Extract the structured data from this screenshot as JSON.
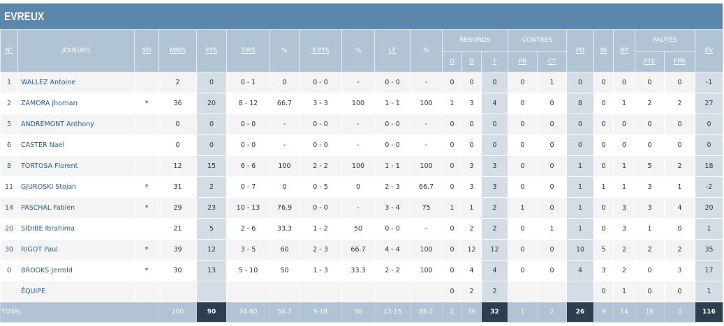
{
  "team": "EVREUX",
  "headers": {
    "num": "N°",
    "player": "JOUEURS",
    "starter": "5D",
    "mins": "MINS",
    "pts": "PTS",
    "shots": "TIRS",
    "pct": "%",
    "three": "3 PTS",
    "ft": "LF",
    "rebounds": "REBONDS",
    "reb_o": "O",
    "reb_d": "D",
    "reb_t": "T",
    "blocks": "CONTRES",
    "blk_pr": "PR",
    "blk_ct": "CT",
    "assists": "PD",
    "steals": "IN",
    "turnovers": "BP",
    "fouls": "FAUTES",
    "fouls_fte": "FTE",
    "fouls_fpr": "FPR",
    "eval": "ÉV"
  },
  "rows": [
    {
      "num": "1",
      "name": "WALLEZ Antoine",
      "starter": "",
      "mins": "2",
      "pts": "0",
      "tirs": "0 - 1",
      "tirs_pct": "0",
      "three": "0 - 0",
      "three_pct": "-",
      "lf": "0 - 0",
      "lf_pct": "-",
      "ro": "0",
      "rd": "0",
      "rt": "0",
      "pr": "0",
      "ct": "1",
      "pd": "0",
      "in": "0",
      "bp": "0",
      "fte": "0",
      "fpr": "0",
      "ev": "-1"
    },
    {
      "num": "2",
      "name": "ZAMORA Jhornan",
      "starter": "*",
      "mins": "36",
      "pts": "20",
      "tirs": "8 - 12",
      "tirs_pct": "66.7",
      "three": "3 - 3",
      "three_pct": "100",
      "lf": "1 - 1",
      "lf_pct": "100",
      "ro": "1",
      "rd": "3",
      "rt": "4",
      "pr": "0",
      "ct": "0",
      "pd": "8",
      "in": "0",
      "bp": "1",
      "fte": "2",
      "fpr": "2",
      "ev": "27"
    },
    {
      "num": "5",
      "name": "ANDREMONT Anthony",
      "starter": "",
      "mins": "0",
      "pts": "0",
      "tirs": "0 - 0",
      "tirs_pct": "-",
      "three": "0 - 0",
      "three_pct": "-",
      "lf": "0 - 0",
      "lf_pct": "-",
      "ro": "0",
      "rd": "0",
      "rt": "0",
      "pr": "0",
      "ct": "0",
      "pd": "0",
      "in": "0",
      "bp": "0",
      "fte": "0",
      "fpr": "0",
      "ev": "0"
    },
    {
      "num": "6",
      "name": "CASTER Nael",
      "starter": "",
      "mins": "0",
      "pts": "0",
      "tirs": "0 - 0",
      "tirs_pct": "-",
      "three": "0 - 0",
      "three_pct": "-",
      "lf": "0 - 0",
      "lf_pct": "-",
      "ro": "0",
      "rd": "0",
      "rt": "0",
      "pr": "0",
      "ct": "0",
      "pd": "0",
      "in": "0",
      "bp": "0",
      "fte": "0",
      "fpr": "0",
      "ev": "0"
    },
    {
      "num": "8",
      "name": "TORTOSA Florent",
      "starter": "",
      "mins": "12",
      "pts": "15",
      "tirs": "6 - 6",
      "tirs_pct": "100",
      "three": "2 - 2",
      "three_pct": "100",
      "lf": "1 - 1",
      "lf_pct": "100",
      "ro": "0",
      "rd": "3",
      "rt": "3",
      "pr": "0",
      "ct": "0",
      "pd": "1",
      "in": "0",
      "bp": "1",
      "fte": "5",
      "fpr": "2",
      "ev": "18"
    },
    {
      "num": "11",
      "name": "GJUROSKI Stojan",
      "starter": "*",
      "mins": "31",
      "pts": "2",
      "tirs": "0 - 7",
      "tirs_pct": "0",
      "three": "0 - 5",
      "three_pct": "0",
      "lf": "2 - 3",
      "lf_pct": "66.7",
      "ro": "0",
      "rd": "3",
      "rt": "3",
      "pr": "0",
      "ct": "0",
      "pd": "1",
      "in": "1",
      "bp": "1",
      "fte": "3",
      "fpr": "1",
      "ev": "-2"
    },
    {
      "num": "14",
      "name": "PASCHAL Fabien",
      "starter": "*",
      "mins": "29",
      "pts": "23",
      "tirs": "10 - 13",
      "tirs_pct": "76.9",
      "three": "0 - 0",
      "three_pct": "-",
      "lf": "3 - 4",
      "lf_pct": "75",
      "ro": "1",
      "rd": "1",
      "rt": "2",
      "pr": "1",
      "ct": "0",
      "pd": "1",
      "in": "0",
      "bp": "3",
      "fte": "3",
      "fpr": "4",
      "ev": "20"
    },
    {
      "num": "20",
      "name": "SIDIBE Ibrahima",
      "starter": "",
      "mins": "21",
      "pts": "5",
      "tirs": "2 - 6",
      "tirs_pct": "33.3",
      "three": "1 - 2",
      "three_pct": "50",
      "lf": "0 - 0",
      "lf_pct": "-",
      "ro": "0",
      "rd": "2",
      "rt": "2",
      "pr": "0",
      "ct": "1",
      "pd": "1",
      "in": "0",
      "bp": "3",
      "fte": "1",
      "fpr": "0",
      "ev": "1"
    },
    {
      "num": "30",
      "name": "RIGOT Paul",
      "starter": "*",
      "mins": "39",
      "pts": "12",
      "tirs": "3 - 5",
      "tirs_pct": "60",
      "three": "2 - 3",
      "three_pct": "66.7",
      "lf": "4 - 4",
      "lf_pct": "100",
      "ro": "0",
      "rd": "12",
      "rt": "12",
      "pr": "0",
      "ct": "0",
      "pd": "10",
      "in": "5",
      "bp": "2",
      "fte": "2",
      "fpr": "2",
      "ev": "35"
    },
    {
      "num": "0",
      "name": "BROOKS Jerrold",
      "starter": "*",
      "mins": "30",
      "pts": "13",
      "tirs": "5 - 10",
      "tirs_pct": "50",
      "three": "1 - 3",
      "three_pct": "33.3",
      "lf": "2 - 2",
      "lf_pct": "100",
      "ro": "0",
      "rd": "4",
      "rt": "4",
      "pr": "0",
      "ct": "0",
      "pd": "4",
      "in": "3",
      "bp": "2",
      "fte": "0",
      "fpr": "3",
      "ev": "17"
    },
    {
      "num": "",
      "name": "ÉQUIPE",
      "starter": "",
      "mins": "",
      "pts": "",
      "tirs": "",
      "tirs_pct": "",
      "three": "",
      "three_pct": "",
      "lf": "",
      "lf_pct": "",
      "ro": "0",
      "rd": "2",
      "rt": "2",
      "pr": "",
      "ct": "",
      "pd": "",
      "in": "0",
      "bp": "1",
      "fte": "0",
      "fpr": "0",
      "ev": "1"
    }
  ],
  "total": {
    "label": "TOTAL",
    "mins": "200",
    "pts": "90",
    "tirs": "34-60",
    "tirs_pct": "56.7",
    "three": "9-18",
    "three_pct": "50",
    "lf": "13-15",
    "lf_pct": "86.7",
    "ro": "2",
    "rd": "30",
    "rt": "32",
    "pr": "1",
    "ct": "2",
    "pd": "26",
    "in": "9",
    "bp": "14",
    "fte": "16",
    "fpr": "0",
    "ev": "116"
  },
  "colors": {
    "title_bg": "#5b87ad",
    "header_bg": "#b1c4d3",
    "highlight_col": "#d4dde6",
    "total_dark": "#2d3e4e",
    "link": "#2a5e93"
  }
}
